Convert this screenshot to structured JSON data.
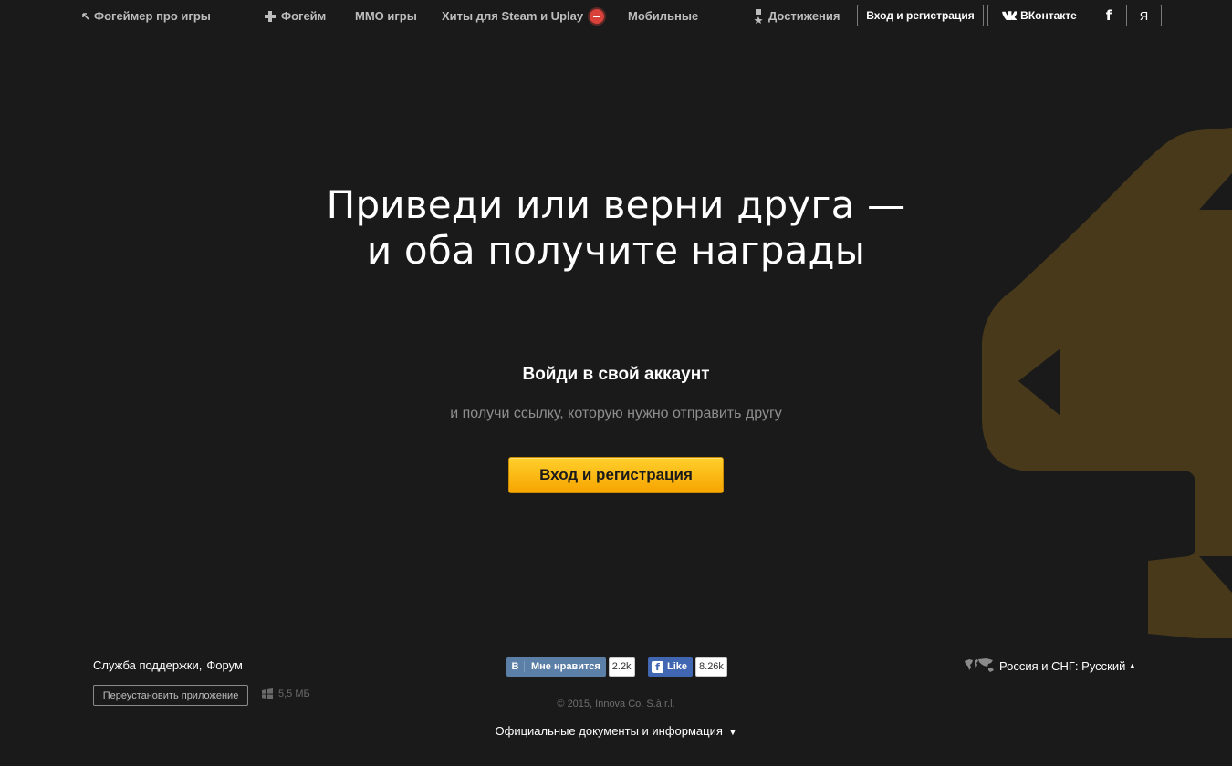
{
  "nav": {
    "back_label": "Фогеймер про игры",
    "fogame_label": "Фогейм",
    "mmo_label": "MMO игры",
    "hits_label": "Хиты для Steam и Uplay",
    "mobile_label": "Мобильные",
    "achievements_label": "Достижения",
    "login_label": "Вход и регистрация",
    "vk_label": "ВКонтакте",
    "fb_label": "f",
    "ya_label": "Я"
  },
  "hero": {
    "title_line1": "Приведи или верни друга —",
    "title_line2": "и оба получите награды",
    "login_heading": "Войди в свой аккаунт",
    "login_sub": "и получи ссылку, которую нужно отправить другу",
    "cta_label": "Вход и регистрация"
  },
  "footer": {
    "support_label": "Служба поддержки",
    "separator": ",",
    "forum_label": "Форум",
    "reinstall_label": "Переустановить приложение",
    "app_size": "5,5 МБ",
    "vk_share_logo": "В",
    "vk_share_label": "Мне нравится",
    "vk_share_count": "2.2k",
    "fb_share_logo": "f",
    "fb_share_label": "Like",
    "fb_share_count": "8.26k",
    "copyright": "© 2015, Innova Co. S.à r.l.",
    "docs_label": "Официальные документы и информация",
    "docs_arrow": "▼",
    "lang_label": "Россия и СНГ: Русский",
    "lang_arrow": "▲"
  },
  "colors": {
    "background": "#1a1a1a",
    "accent_yellow": "#f7a400",
    "mascot": "#47391a",
    "hits_badge": "#d9423a"
  }
}
